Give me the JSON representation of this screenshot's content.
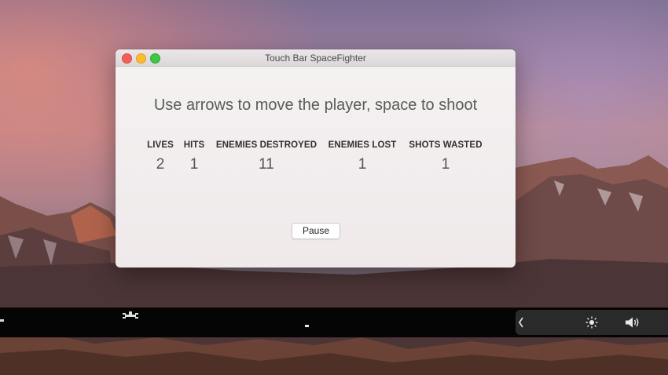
{
  "window": {
    "title": "Touch Bar SpaceFighter",
    "instructions": "Use arrows to move the player, space to shoot"
  },
  "stats": [
    {
      "label": "LIVES",
      "value": "2"
    },
    {
      "label": "HITS",
      "value": "1"
    },
    {
      "label": "ENEMIES DESTROYED",
      "value": "11"
    },
    {
      "label": "ENEMIES LOST",
      "value": "1"
    },
    {
      "label": "SHOTS WASTED",
      "value": "1"
    }
  ],
  "controls": {
    "pause_label": "Pause"
  },
  "touch_bar": {
    "icons": [
      "player-ship-icon",
      "collapse-chevron-icon",
      "brightness-icon",
      "volume-icon"
    ]
  },
  "colors": {
    "close": "#f25f58",
    "minimize": "#f9bd2e",
    "maximize": "#3ec645",
    "touch_bar_bg": "#050505"
  }
}
